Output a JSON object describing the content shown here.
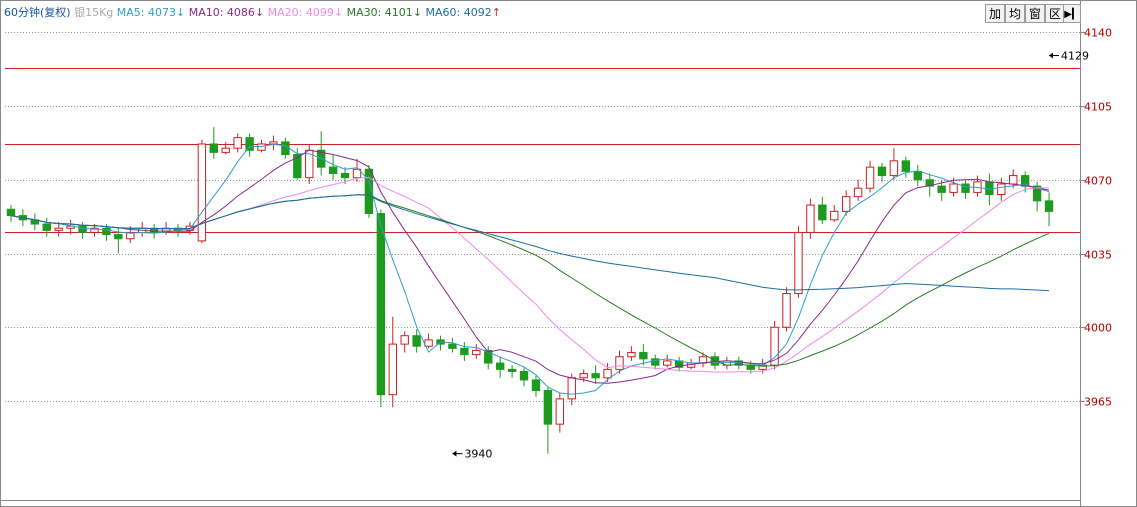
{
  "header": {
    "period_label": "60分钟(复权)",
    "symbol": "银15Kg",
    "indicators": [
      {
        "label": "MA5:",
        "value": "4073",
        "arrow": "↓",
        "color": "#2fa0c8"
      },
      {
        "label": "MA10:",
        "value": "4086",
        "arrow": "↓",
        "color": "#8b2a8b"
      },
      {
        "label": "MA20:",
        "value": "4099",
        "arrow": "↓",
        "color": "#ee88ee"
      },
      {
        "label": "MA30:",
        "value": "4101",
        "arrow": "↓",
        "color": "#2a7a2a"
      },
      {
        "label": "MA60:",
        "value": "4092",
        "arrow": "↑",
        "color": "#1a6fa0"
      }
    ]
  },
  "toolbar": {
    "buttons": [
      "加",
      "均",
      "窗",
      "区"
    ],
    "nav_icon": "play-to-end-icon"
  },
  "colors": {
    "up": "#cc2222",
    "down": "#1e9a1e",
    "grid": "#999999",
    "hline": "#cc2222",
    "axis_text": "#b00000"
  },
  "chart_data": {
    "type": "candlestick",
    "y_range": [
      3918,
      4143
    ],
    "y_ticks": [
      "4140",
      "4105",
      "4070",
      "4035",
      "4000",
      "3965"
    ],
    "horizontal_lines": [
      4123,
      4087,
      4045
    ],
    "annotations": [
      {
        "text": "4129",
        "value": 4129,
        "bar_index": 87
      },
      {
        "text": "3940",
        "value": 3940,
        "bar_index": 37
      }
    ],
    "candles": [
      [
        4056,
        4053,
        4058,
        4050
      ],
      [
        4053,
        4051,
        4056,
        4048
      ],
      [
        4051,
        4049,
        4054,
        4046
      ],
      [
        4049,
        4046,
        4052,
        4043
      ],
      [
        4046,
        4047,
        4050,
        4043
      ],
      [
        4047,
        4048,
        4051,
        4044
      ],
      [
        4048,
        4045,
        4050,
        4042
      ],
      [
        4045,
        4047,
        4049,
        4043
      ],
      [
        4047,
        4044,
        4049,
        4041
      ],
      [
        4044,
        4042,
        4047,
        4035
      ],
      [
        4042,
        4045,
        4048,
        4040
      ],
      [
        4045,
        4047,
        4050,
        4043
      ],
      [
        4047,
        4045,
        4049,
        4042
      ],
      [
        4045,
        4047,
        4050,
        4044
      ],
      [
        4047,
        4046,
        4049,
        4043
      ],
      [
        4046,
        4048,
        4050,
        4044
      ],
      [
        4041,
        4087,
        4089,
        4040
      ],
      [
        4087,
        4083,
        4095,
        4080
      ],
      [
        4083,
        4085,
        4088,
        4082
      ],
      [
        4085,
        4090,
        4092,
        4083
      ],
      [
        4090,
        4084,
        4092,
        4081
      ],
      [
        4084,
        4087,
        4089,
        4083
      ],
      [
        4087,
        4088,
        4091,
        4084
      ],
      [
        4088,
        4082,
        4090,
        4080
      ],
      [
        4082,
        4071,
        4085,
        4070
      ],
      [
        4071,
        4084,
        4087,
        4068
      ],
      [
        4084,
        4076,
        4093,
        4072
      ],
      [
        4076,
        4073,
        4082,
        4070
      ],
      [
        4073,
        4071,
        4076,
        4068
      ],
      [
        4071,
        4075,
        4080,
        4069
      ],
      [
        4075,
        4054,
        4077,
        4052
      ],
      [
        4054,
        3968,
        4056,
        3962
      ],
      [
        3968,
        3992,
        4005,
        3962
      ],
      [
        3992,
        3996,
        3998,
        3988
      ],
      [
        3996,
        3991,
        3999,
        3988
      ],
      [
        3991,
        3994,
        3997,
        3990
      ],
      [
        3994,
        3992,
        3996,
        3989
      ],
      [
        3992,
        3990,
        3995,
        3988
      ],
      [
        3990,
        3987,
        3993,
        3984
      ],
      [
        3987,
        3989,
        3992,
        3985
      ],
      [
        3989,
        3983,
        3991,
        3980
      ],
      [
        3983,
        3980,
        3986,
        3976
      ],
      [
        3980,
        3979,
        3982,
        3976
      ],
      [
        3979,
        3975,
        3981,
        3972
      ],
      [
        3975,
        3970,
        3977,
        3967
      ],
      [
        3970,
        3954,
        3972,
        3940
      ],
      [
        3954,
        3966,
        3969,
        3950
      ],
      [
        3966,
        3976,
        3978,
        3963
      ],
      [
        3976,
        3978,
        3980,
        3974
      ],
      [
        3978,
        3976,
        3982,
        3973
      ],
      [
        3976,
        3980,
        3983,
        3974
      ],
      [
        3980,
        3986,
        3989,
        3978
      ],
      [
        3986,
        3988,
        3991,
        3984
      ],
      [
        3988,
        3985,
        3992,
        3982
      ],
      [
        3985,
        3982,
        3987,
        3980
      ],
      [
        3982,
        3984,
        3987,
        3981
      ],
      [
        3984,
        3981,
        3986,
        3979
      ],
      [
        3981,
        3983,
        3985,
        3980
      ],
      [
        3983,
        3986,
        3988,
        3981
      ],
      [
        3986,
        3982,
        3988,
        3980
      ],
      [
        3982,
        3984,
        3986,
        3980
      ],
      [
        3984,
        3982,
        3986,
        3980
      ],
      [
        3982,
        3980,
        3984,
        3978
      ],
      [
        3980,
        3982,
        3985,
        3978
      ],
      [
        3982,
        4000,
        4003,
        3980
      ],
      [
        4000,
        4016,
        4019,
        3998
      ],
      [
        4016,
        4045,
        4048,
        4014
      ],
      [
        4045,
        4058,
        4061,
        4042
      ],
      [
        4058,
        4051,
        4062,
        4049
      ],
      [
        4051,
        4055,
        4058,
        4050
      ],
      [
        4055,
        4062,
        4065,
        4053
      ],
      [
        4062,
        4066,
        4070,
        4060
      ],
      [
        4066,
        4076,
        4079,
        4064
      ],
      [
        4076,
        4072,
        4078,
        4069
      ],
      [
        4072,
        4079,
        4085,
        4070
      ],
      [
        4079,
        4074,
        4081,
        4071
      ],
      [
        4074,
        4070,
        4077,
        4067
      ],
      [
        4070,
        4067,
        4073,
        4062
      ],
      [
        4067,
        4064,
        4070,
        4060
      ],
      [
        4064,
        4068,
        4071,
        4062
      ],
      [
        4068,
        4064,
        4070,
        4061
      ],
      [
        4064,
        4069,
        4072,
        4062
      ],
      [
        4069,
        4063,
        4073,
        4058
      ],
      [
        4063,
        4068,
        4071,
        4060
      ],
      [
        4068,
        4072,
        4075,
        4066
      ],
      [
        4072,
        4067,
        4074,
        4064
      ],
      [
        4067,
        4060,
        4069,
        4055
      ],
      [
        4060,
        4055,
        4064,
        4048
      ]
    ],
    "ma5": [],
    "ma10": [],
    "ma20": [],
    "ma30": [],
    "ma60": []
  }
}
